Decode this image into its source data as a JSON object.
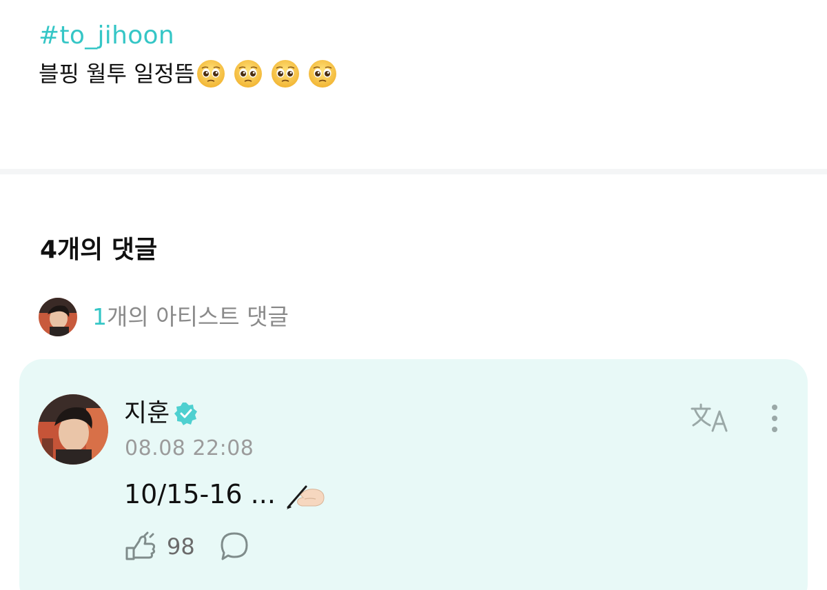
{
  "post": {
    "hashtag": "#to_jihoon",
    "text": "블핑 월투 일정뜸",
    "emojis": [
      "pleading-face-emoji",
      "pleading-face-emoji",
      "pleading-face-emoji",
      "pleading-face-emoji"
    ]
  },
  "comments": {
    "title": "4개의 댓글",
    "artist_count": "1",
    "artist_label": "개의 아티스트 댓글"
  },
  "artist_comment": {
    "author": "지훈",
    "timestamp": "08.08 22:08",
    "text": "10/15-16 ...",
    "trailing_emoji": "writing-hand-emoji",
    "like_count": "98"
  },
  "colors": {
    "accent": "#35c6c6",
    "card_background": "#e8f9f7",
    "muted_text": "#9b9b9b",
    "icon_gray": "#8c9a99"
  }
}
